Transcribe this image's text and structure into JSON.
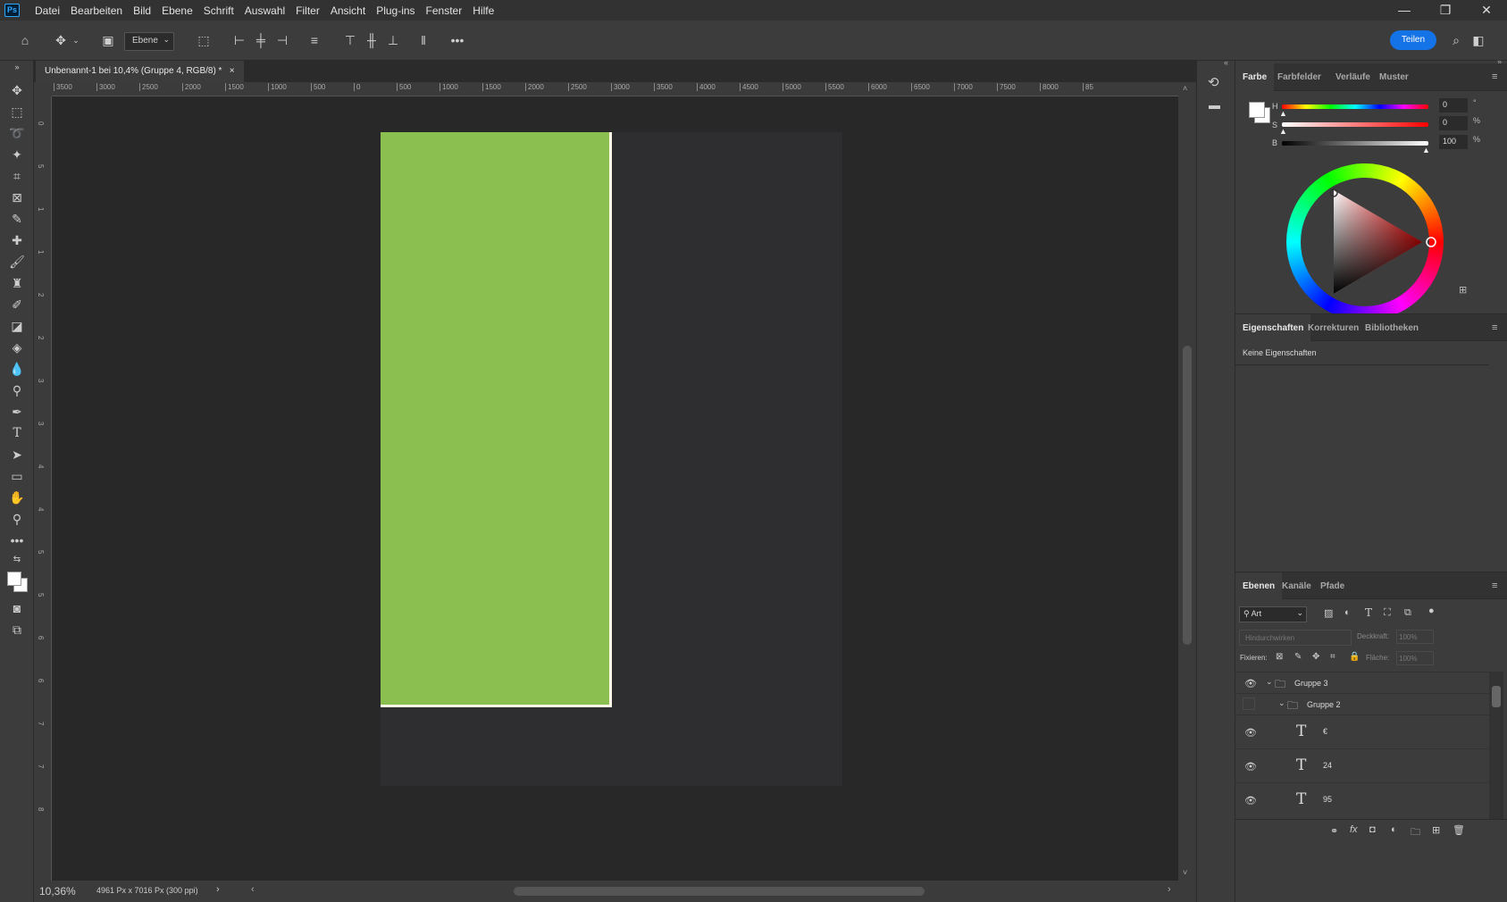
{
  "app": {
    "logo": "Ps"
  },
  "menu": [
    "Datei",
    "Bearbeiten",
    "Bild",
    "Ebene",
    "Schrift",
    "Auswahl",
    "Filter",
    "Ansicht",
    "Plug-ins",
    "Fenster",
    "Hilfe"
  ],
  "window_controls": {
    "minimize": "—",
    "restore": "❐",
    "close": "✕"
  },
  "options_bar": {
    "layer_select": "Ebene",
    "share": "Teilen"
  },
  "document": {
    "tab_title": "Unbenannt-1 bei 10,4% (Gruppe 4, RGB/8) *",
    "close": "×",
    "zoom": "10,36%",
    "size_info": "4961 Px x 7016 Px (300 ppi)"
  },
  "ruler": {
    "h_labels": [
      "3500",
      "3000",
      "2500",
      "2000",
      "1500",
      "1000",
      "500",
      "0",
      "500",
      "1000",
      "1500",
      "2000",
      "2500",
      "3000",
      "3500",
      "4000",
      "4500",
      "5000",
      "5500",
      "6000",
      "6500",
      "7000",
      "7500",
      "8000",
      "85"
    ],
    "v_labels": [
      "0",
      "5",
      "1",
      "1",
      "2",
      "2",
      "3",
      "3",
      "4",
      "4",
      "5",
      "5",
      "6",
      "6",
      "7",
      "7",
      "8"
    ]
  },
  "colors": {
    "artboard_fill": "#8bbf4f",
    "accent": "#1473e6"
  },
  "color_panel": {
    "tabs": [
      "Farbe",
      "Farbfelder",
      "Verläufe",
      "Muster"
    ],
    "sliders": [
      {
        "label": "H",
        "value": "0",
        "unit": "°",
        "level": 0
      },
      {
        "label": "S",
        "value": "0",
        "unit": "%",
        "level": 0
      },
      {
        "label": "B",
        "value": "100",
        "unit": "%",
        "level": 1
      }
    ]
  },
  "properties_panel": {
    "tabs": [
      "Eigenschaften",
      "Korrekturen",
      "Bibliotheken"
    ],
    "empty_text": "Keine Eigenschaften"
  },
  "layers_panel": {
    "tabs": [
      "Ebenen",
      "Kanäle",
      "Pfade"
    ],
    "filter_label": "Art",
    "blend_mode": "Hindurchwirken",
    "opacity_label": "Deckkraft:",
    "opacity_value": "100%",
    "lock_label": "Fixieren:",
    "fill_label": "Fläche:",
    "fill_value": "100%",
    "layers": [
      {
        "name": "Gruppe 3",
        "type": "group",
        "visible": true
      },
      {
        "name": "Gruppe 2",
        "type": "group",
        "visible": false
      },
      {
        "name": "€",
        "type": "text",
        "visible": true
      },
      {
        "name": "24",
        "type": "text",
        "visible": true
      },
      {
        "name": "95",
        "type": "text",
        "visible": true
      }
    ]
  }
}
